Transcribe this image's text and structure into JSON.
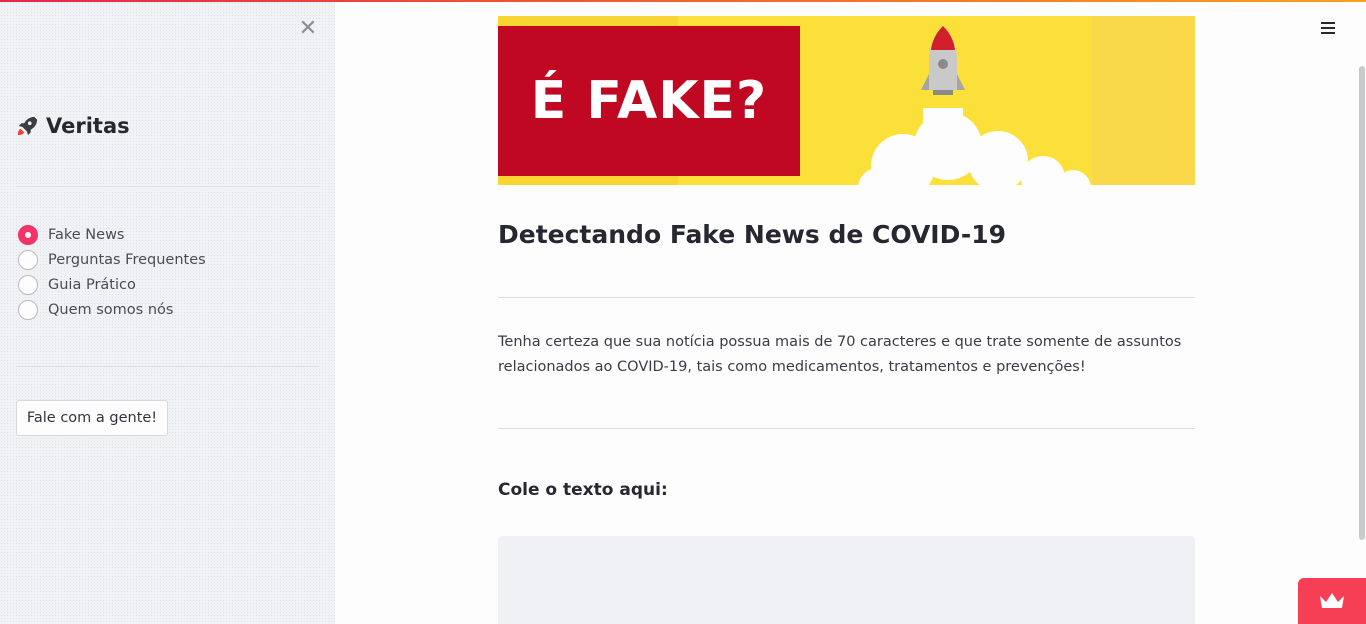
{
  "sidebar": {
    "close_icon": "close-icon",
    "brand": {
      "icon": "rocket-icon",
      "title": "Veritas"
    },
    "nav": {
      "selected_index": 0,
      "items": [
        {
          "label": "Fake News",
          "selected": true
        },
        {
          "label": "Perguntas Frequentes",
          "selected": false
        },
        {
          "label": "Guia Prático",
          "selected": false
        },
        {
          "label": "Quem somos nós",
          "selected": false
        }
      ]
    },
    "contact_button": "Fale com a gente!"
  },
  "header": {
    "menu_icon": "hamburger-menu-icon"
  },
  "hero": {
    "text": "É FAKE?",
    "icon": "rocket-launch-illustration"
  },
  "main": {
    "title": "Detectando Fake News de COVID-19",
    "description": "Tenha certeza que sua notícia possua mais de 70 caracteres e que trate somente de assuntos relacionados ao COVID-19, tais como medicamentos, tratamentos e prevenções!",
    "input_label": "Cole o texto aqui:",
    "textarea_value": ""
  },
  "footer": {
    "badge_icon": "crown-icon"
  },
  "colors": {
    "accent": "#f63366",
    "hero_red": "#c00822",
    "hero_yellow": "#f8d531",
    "badge": "#f63e54"
  }
}
